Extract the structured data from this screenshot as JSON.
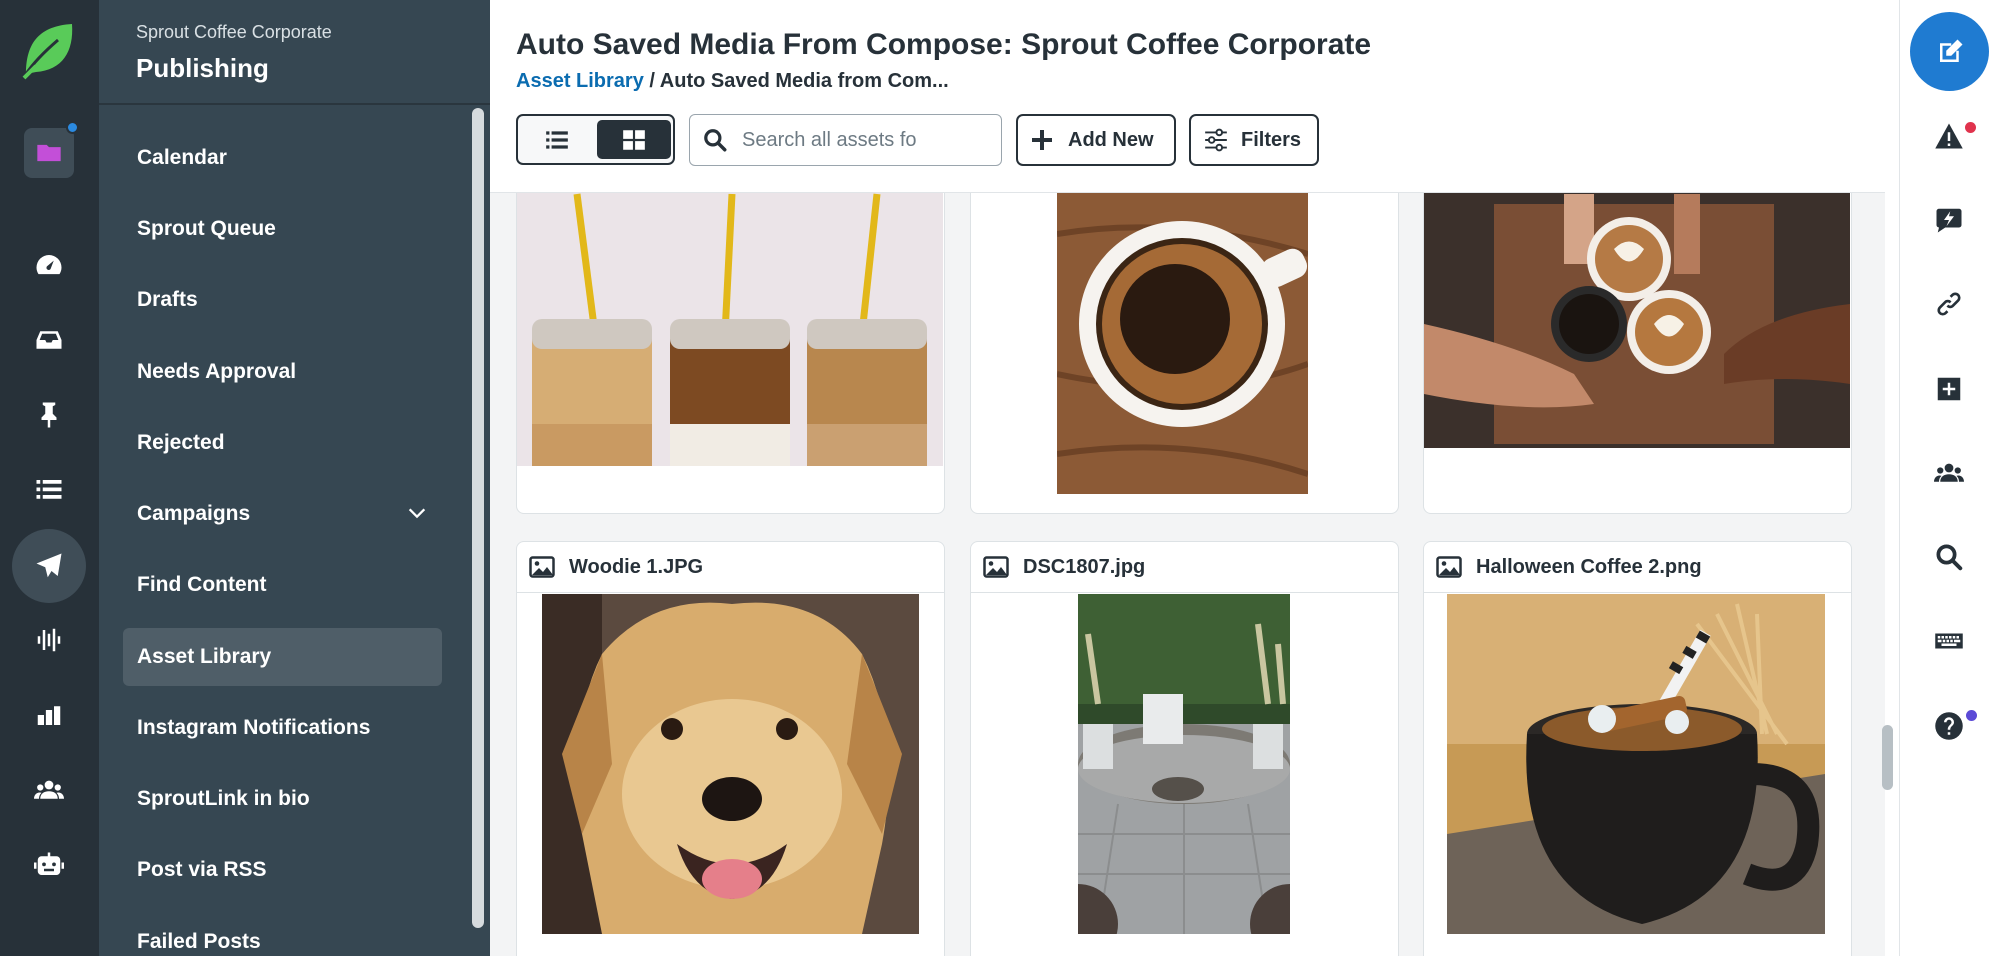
{
  "rail": {
    "items": [
      "logo",
      "folder-icon",
      "dashboard-icon",
      "inbox-icon",
      "pin-icon",
      "list-icon",
      "publishing-icon",
      "listening-icon",
      "reports-icon",
      "people-icon",
      "bot-icon"
    ]
  },
  "nav": {
    "org_name": "Sprout Coffee Corporate",
    "section_title": "Publishing",
    "items": [
      {
        "label": "Calendar"
      },
      {
        "label": "Sprout Queue"
      },
      {
        "label": "Drafts"
      },
      {
        "label": "Needs Approval"
      },
      {
        "label": "Rejected"
      },
      {
        "label": "Campaigns"
      },
      {
        "label": "Find Content"
      },
      {
        "label": "Asset Library"
      },
      {
        "label": "Instagram Notifications"
      },
      {
        "label": "SproutLink in bio"
      },
      {
        "label": "Post via RSS"
      },
      {
        "label": "Failed Posts"
      }
    ],
    "active_item": "Asset Library"
  },
  "main": {
    "title": "Auto Saved Media From Compose: Sprout Coffee Corporate",
    "breadcrumb": {
      "link": "Asset Library",
      "separator": " / ",
      "current": "Auto Saved Media from Com..."
    },
    "toolbar": {
      "search_placeholder": "Search all assets fo",
      "add_new_label": "Add New",
      "filters_label": "Filters"
    },
    "assets": [
      {
        "name": "",
        "kind": "iced-coffee-jars"
      },
      {
        "name": "",
        "kind": "black-coffee-cup"
      },
      {
        "name": "",
        "kind": "latte-cheers"
      },
      {
        "name": "Woodie 1.JPG",
        "kind": "golden-retriever"
      },
      {
        "name": "DSC1807.jpg",
        "kind": "patio-firepit"
      },
      {
        "name": "Halloween Coffee 2.png",
        "kind": "cauldron-mug"
      }
    ]
  },
  "colors": {
    "rail_bg": "#273139",
    "nav_bg": "#364752",
    "nav_active_bg": "#4f5e68",
    "accent_blue": "#1f7bd1",
    "link_blue": "#0b6cb0",
    "brand_green": "#59cb59",
    "alert_red": "#e0334d",
    "notify_purple": "#5b4ad6"
  }
}
